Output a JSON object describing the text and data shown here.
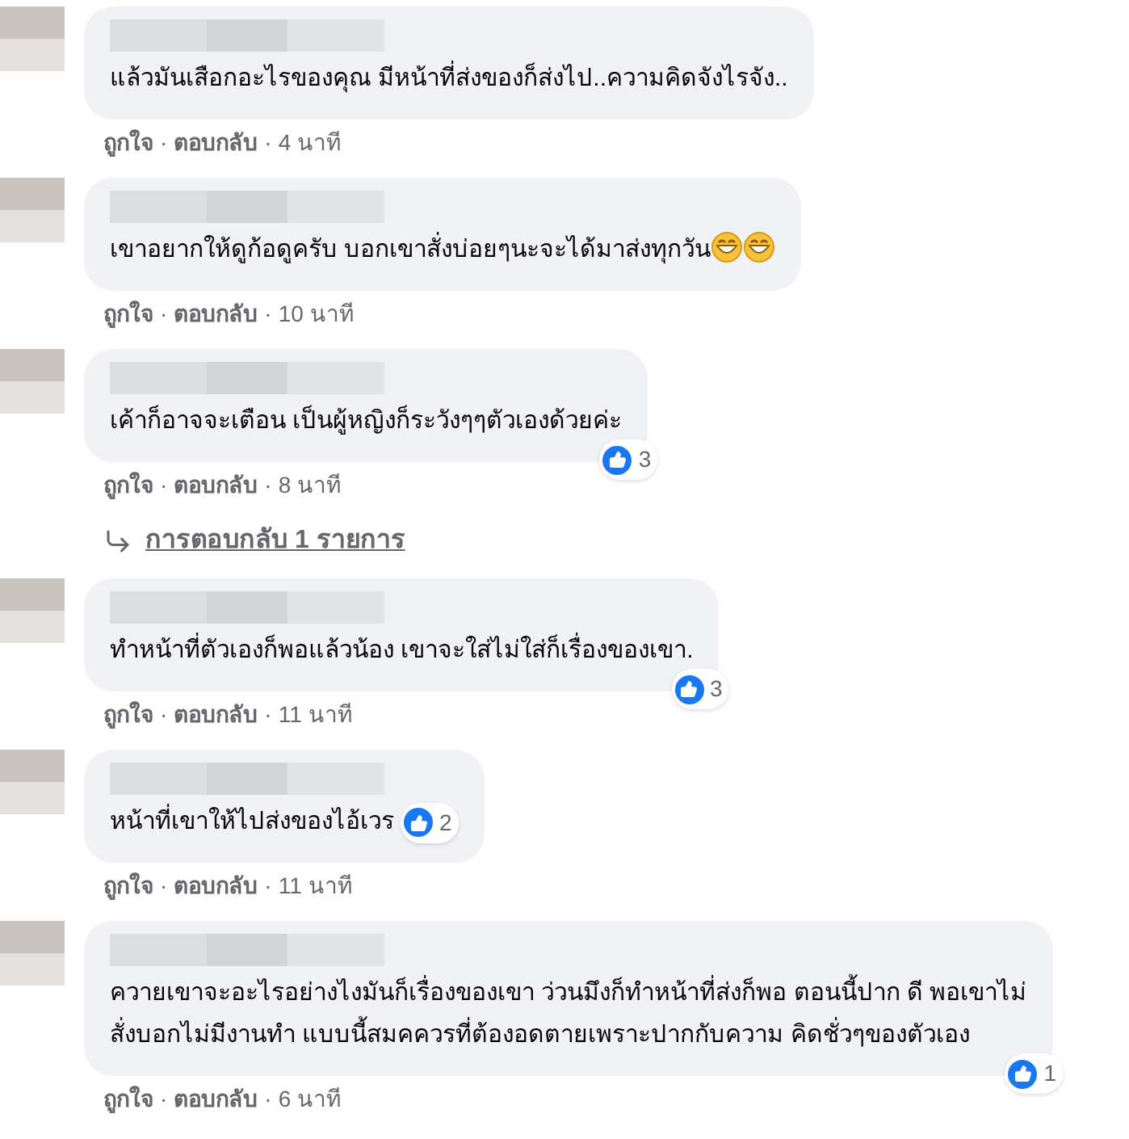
{
  "separator": "·",
  "comments": [
    {
      "text": "แล้วมันเสือกอะไรของคุณ มีหน้าที่ส่งของก็ส่งไป..ความคิดจังไรจัง..",
      "like": "ถูกใจ",
      "reply": "ตอบกลับ",
      "time": "4 นาที"
    },
    {
      "text": "เขาอยากให้ดูก้อดูครับ บอกเขาสั่งบ่อยๆนะจะได้มาส่งทุกวัน",
      "emojis": [
        {
          "kind": "grin"
        },
        {
          "kind": "grin"
        }
      ],
      "like": "ถูกใจ",
      "reply": "ตอบกลับ",
      "time": "10 นาที"
    },
    {
      "text": "เค้าก็อาจจะเตือน เป็นผู้หญิงก็ระวังๆๆตัวเองด้วยค่ะ",
      "reactions": {
        "count": "3",
        "kind": "corner"
      },
      "like": "ถูกใจ",
      "reply": "ตอบกลับ",
      "time": "8 นาที",
      "replies_link": "การตอบกลับ 1 รายการ"
    },
    {
      "text": "ทำหน้าที่ตัวเองก็พอแล้วน้อง เขาจะใส่ไม่ใส่ก็เรื่องของเขา.",
      "reactions": {
        "count": "3",
        "kind": "corner"
      },
      "like": "ถูกใจ",
      "reply": "ตอบกลับ",
      "time": "11 นาที"
    },
    {
      "text": "หน้าที่เขาให้ไปส่งของไอ้เวร",
      "reactions": {
        "count": "2",
        "kind": "inline"
      },
      "like": "ถูกใจ",
      "reply": "ตอบกลับ",
      "time": "11 นาที"
    },
    {
      "text": "ควายเขาจะอะไรอย่างไงมันก็เรื่องของเขา ว่วนมึงก็ทำหน้าที่ส่งก็พอ ตอนนี้ปาก ดี พอเขาไม่สั่งบอกไม่มีงานทำ แบบนี้สมคควรที่ต้องอดตายเพราะปากกับความ คิดชั่วๆของตัวเอง",
      "reactions": {
        "count": "1",
        "kind": "corner"
      },
      "like": "ถูกใจ",
      "reply": "ตอบกลับ",
      "time": "6 นาที"
    }
  ]
}
